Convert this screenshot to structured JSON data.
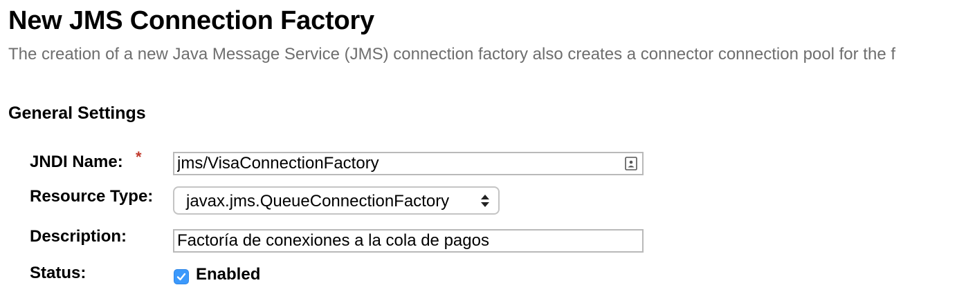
{
  "header": {
    "title": "New JMS Connection Factory",
    "help_text": "The creation of a new Java Message Service (JMS) connection factory also creates a connector connection pool for the f"
  },
  "general_settings": {
    "title": "General Settings",
    "jndi_name": {
      "label": "JNDI Name:",
      "required_marker": "*",
      "value": "jms/VisaConnectionFactory",
      "icon": "contact-card-icon"
    },
    "resource_type": {
      "label": "Resource Type:",
      "selected": "javax.jms.QueueConnectionFactory",
      "icon": "updown-arrows-icon"
    },
    "description": {
      "label": "Description:",
      "value": "Factoría de conexiones a la cola de pagos"
    },
    "status": {
      "label": "Status:",
      "checkbox_label": "Enabled",
      "checked": true,
      "checkbox_color": "#3b99fc"
    }
  }
}
